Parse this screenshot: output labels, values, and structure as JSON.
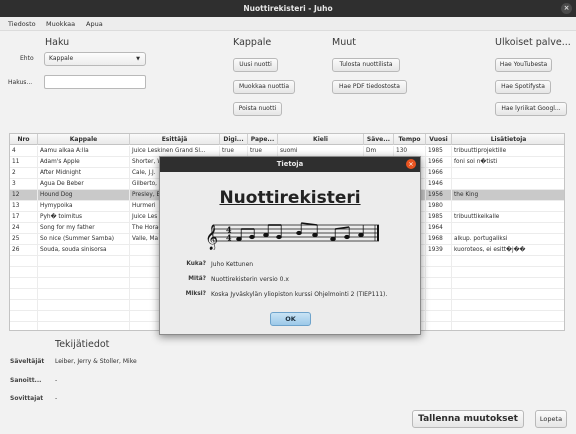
{
  "window": {
    "title": "Nuottirekisteri - Juho",
    "close_glyph": "×"
  },
  "menu": [
    "Tiedosto",
    "Muokkaa",
    "Apua"
  ],
  "search": {
    "title": "Haku",
    "condition_label": "Ehto",
    "condition_value": "Kappale",
    "search_label": "Hakus...",
    "search_value": ""
  },
  "song_panel": {
    "title": "Kappale",
    "buttons": [
      "Uusi nuotti",
      "Muokkaa nuottia",
      "Poista nuotti"
    ]
  },
  "other_panel": {
    "title": "Muut",
    "buttons": [
      "Tulosta nuottilista",
      "Hae PDF tiedostosta"
    ]
  },
  "external_panel": {
    "title": "Ulkoiset palve...",
    "buttons": [
      "Hae YouTubesta",
      "Hae Spotifysta",
      "Hae lyriikat Googl..."
    ]
  },
  "table": {
    "headers": [
      "Nro",
      "Kappale",
      "Esittäjä",
      "Digi...",
      "Pape...",
      "Kieli",
      "Säve...",
      "Tempo",
      "Vuosi",
      "Lisätietoja"
    ],
    "rows": [
      [
        "4",
        "Aamu alkaa A:lla",
        "Juice Leskinen Grand Sl...",
        "true",
        "true",
        "suomi",
        "Dm",
        "130",
        "1985",
        "tribuuttiprojektille"
      ],
      [
        "11",
        "Adam's Apple",
        "Shorter, W",
        "",
        "",
        "",
        "",
        "",
        "1966",
        "foni soi n�tisti"
      ],
      [
        "2",
        "After Midnight",
        "Cale, J.J.",
        "",
        "",
        "",
        "",
        "",
        "1966",
        ""
      ],
      [
        "3",
        "Agua De Beber",
        "Gilberto, A",
        "",
        "",
        "",
        "",
        "",
        "1946",
        ""
      ],
      [
        "12",
        "Hound Dog",
        "Presley, E",
        "",
        "",
        "",
        "",
        "",
        "1956",
        "the King"
      ],
      [
        "13",
        "Hymypoika",
        "Hurmeri",
        "",
        "",
        "",
        "",
        "",
        "1980",
        ""
      ],
      [
        "17",
        "Pyh� toimitus",
        "Juice Les",
        "",
        "",
        "",
        "",
        "",
        "1985",
        "tribuuttikeikalle"
      ],
      [
        "24",
        "Song for my father",
        "The Horac",
        "",
        "",
        "",
        "",
        "",
        "1964",
        ""
      ],
      [
        "25",
        "So nice (Summer Samba)",
        "Valle, Ma",
        "",
        "",
        "",
        "",
        "",
        "1968",
        "alkup. portugaliksi"
      ],
      [
        "26",
        "Souda, souda sinisorsa",
        "",
        "",
        "",
        "",
        "",
        "",
        "1939",
        "kuoroteos, ei esitt�j��"
      ]
    ],
    "selected_row": 4
  },
  "details": {
    "title": "Tekijätiedot",
    "fields": [
      {
        "key": "Säveltäjät",
        "value": "Leiber, Jerry & Stoller, Mike"
      },
      {
        "key": "Sanoitt...",
        "value": "-"
      },
      {
        "key": "Sovittajat",
        "value": "-"
      }
    ]
  },
  "footer": {
    "save_label": "Tallenna muutokset",
    "quit_label": "Lopeta"
  },
  "dialog": {
    "title": "Tietoja",
    "app_name": "Nuottirekisteri",
    "fields": [
      {
        "key": "Kuka?",
        "value": "Juho Kettunen"
      },
      {
        "key": "Mitä?",
        "value": "Nuottirekisterin versio 0.x"
      },
      {
        "key": "Miksi?",
        "value": "Koska Jyväskylän yliopiston kurssi Ohjelmointi 2 (TIEP111)."
      }
    ],
    "ok_label": "OK",
    "close_glyph": "×"
  },
  "colors": {
    "titlebar": "#2f2f2f",
    "close_accent": "#e95420",
    "selected_row": "#c9c9c9",
    "ok_button": "#9cc9e9"
  },
  "icons": [
    "close-icon",
    "dropdown-arrow-icon",
    "music-staff-icon"
  ]
}
